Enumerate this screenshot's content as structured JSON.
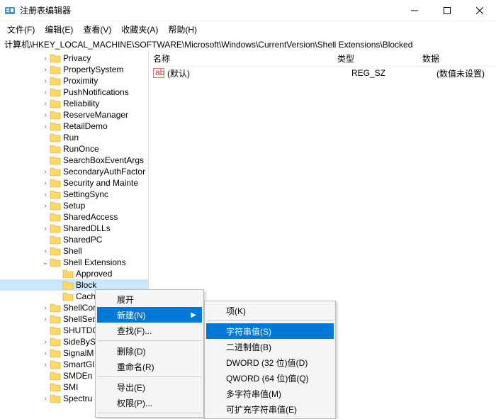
{
  "window": {
    "title": "注册表编辑器"
  },
  "menubar": {
    "file": "文件(F)",
    "edit": "编辑(E)",
    "view": "查看(V)",
    "favorites": "收藏夹(A)",
    "help": "帮助(H)"
  },
  "path": "计算机\\HKEY_LOCAL_MACHINE\\SOFTWARE\\Microsoft\\Windows\\CurrentVersion\\Shell Extensions\\Blocked",
  "tree": {
    "items": [
      {
        "chev": ">",
        "indent": 58,
        "label": "Privacy"
      },
      {
        "chev": ">",
        "indent": 58,
        "label": "PropertySystem"
      },
      {
        "chev": ">",
        "indent": 58,
        "label": "Proximity"
      },
      {
        "chev": ">",
        "indent": 58,
        "label": "PushNotifications"
      },
      {
        "chev": ">",
        "indent": 58,
        "label": "Reliability"
      },
      {
        "chev": ">",
        "indent": 58,
        "label": "ReserveManager"
      },
      {
        "chev": ">",
        "indent": 58,
        "label": "RetailDemo"
      },
      {
        "chev": "",
        "indent": 58,
        "label": "Run"
      },
      {
        "chev": "",
        "indent": 58,
        "label": "RunOnce"
      },
      {
        "chev": "",
        "indent": 58,
        "label": "SearchBoxEventArgs"
      },
      {
        "chev": ">",
        "indent": 58,
        "label": "SecondaryAuthFactor"
      },
      {
        "chev": ">",
        "indent": 58,
        "label": "Security and Mainte"
      },
      {
        "chev": ">",
        "indent": 58,
        "label": "SettingSync"
      },
      {
        "chev": ">",
        "indent": 58,
        "label": "Setup"
      },
      {
        "chev": "",
        "indent": 58,
        "label": "SharedAccess"
      },
      {
        "chev": ">",
        "indent": 58,
        "label": "SharedDLLs"
      },
      {
        "chev": "",
        "indent": 58,
        "label": "SharedPC"
      },
      {
        "chev": ">",
        "indent": 58,
        "label": "Shell"
      },
      {
        "chev": "v",
        "indent": 58,
        "label": "Shell Extensions"
      },
      {
        "chev": "",
        "indent": 76,
        "label": "Approved"
      },
      {
        "chev": "",
        "indent": 76,
        "label": "Block",
        "selected": true
      },
      {
        "chev": "",
        "indent": 76,
        "label": "Cach"
      },
      {
        "chev": ">",
        "indent": 58,
        "label": "ShellCor"
      },
      {
        "chev": ">",
        "indent": 58,
        "label": "ShellSer"
      },
      {
        "chev": "",
        "indent": 58,
        "label": "SHUTDO"
      },
      {
        "chev": ">",
        "indent": 58,
        "label": "SideByS"
      },
      {
        "chev": ">",
        "indent": 58,
        "label": "SignalM"
      },
      {
        "chev": ">",
        "indent": 58,
        "label": "SmartGl"
      },
      {
        "chev": "",
        "indent": 58,
        "label": "SMDEn"
      },
      {
        "chev": "",
        "indent": 58,
        "label": "SMI"
      },
      {
        "chev": ">",
        "indent": 58,
        "label": "Spectru"
      }
    ]
  },
  "list": {
    "cols": {
      "name": "名称",
      "type": "类型",
      "data": "数据"
    },
    "rows": [
      {
        "name": "(默认)",
        "type": "REG_SZ",
        "data": "(数值未设置)"
      }
    ]
  },
  "menu1": {
    "expand": "展开",
    "new": "新建(N)",
    "find": "查找(F)...",
    "delete": "删除(D)",
    "rename": "重命名(R)",
    "export": "导出(E)",
    "perm": "权限(P)..."
  },
  "menu2": {
    "key": "项(K)",
    "string": "字符串值(S)",
    "binary": "二进制值(B)",
    "dword": "DWORD (32 位)值(D)",
    "qword": "QWORD (64 位)值(Q)",
    "multi": "多字符串值(M)",
    "expand": "可扩充字符串值(E)"
  }
}
